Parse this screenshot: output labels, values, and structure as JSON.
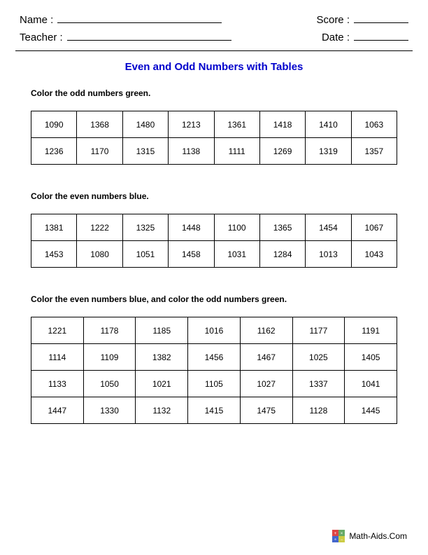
{
  "header": {
    "name_label": "Name :",
    "teacher_label": "Teacher :",
    "score_label": "Score :",
    "date_label": "Date :"
  },
  "title": "Even and Odd Numbers with Tables",
  "sections": [
    {
      "instruction": "Color the odd numbers green.",
      "cols": 8,
      "rows": [
        [
          "1090",
          "1368",
          "1480",
          "1213",
          "1361",
          "1418",
          "1410",
          "1063"
        ],
        [
          "1236",
          "1170",
          "1315",
          "1138",
          "1111",
          "1269",
          "1319",
          "1357"
        ]
      ]
    },
    {
      "instruction": "Color the even numbers blue.",
      "cols": 8,
      "rows": [
        [
          "1381",
          "1222",
          "1325",
          "1448",
          "1100",
          "1365",
          "1454",
          "1067"
        ],
        [
          "1453",
          "1080",
          "1051",
          "1458",
          "1031",
          "1284",
          "1013",
          "1043"
        ]
      ]
    },
    {
      "instruction": "Color the even numbers blue, and color the odd numbers green.",
      "cols": 7,
      "rows": [
        [
          "1221",
          "1178",
          "1185",
          "1016",
          "1162",
          "1177",
          "1191"
        ],
        [
          "1114",
          "1109",
          "1382",
          "1456",
          "1467",
          "1025",
          "1405"
        ],
        [
          "1133",
          "1050",
          "1021",
          "1105",
          "1027",
          "1337",
          "1041"
        ],
        [
          "1447",
          "1330",
          "1132",
          "1415",
          "1475",
          "1128",
          "1445"
        ]
      ]
    }
  ],
  "footer": {
    "site": "Math-Aids.Com"
  }
}
